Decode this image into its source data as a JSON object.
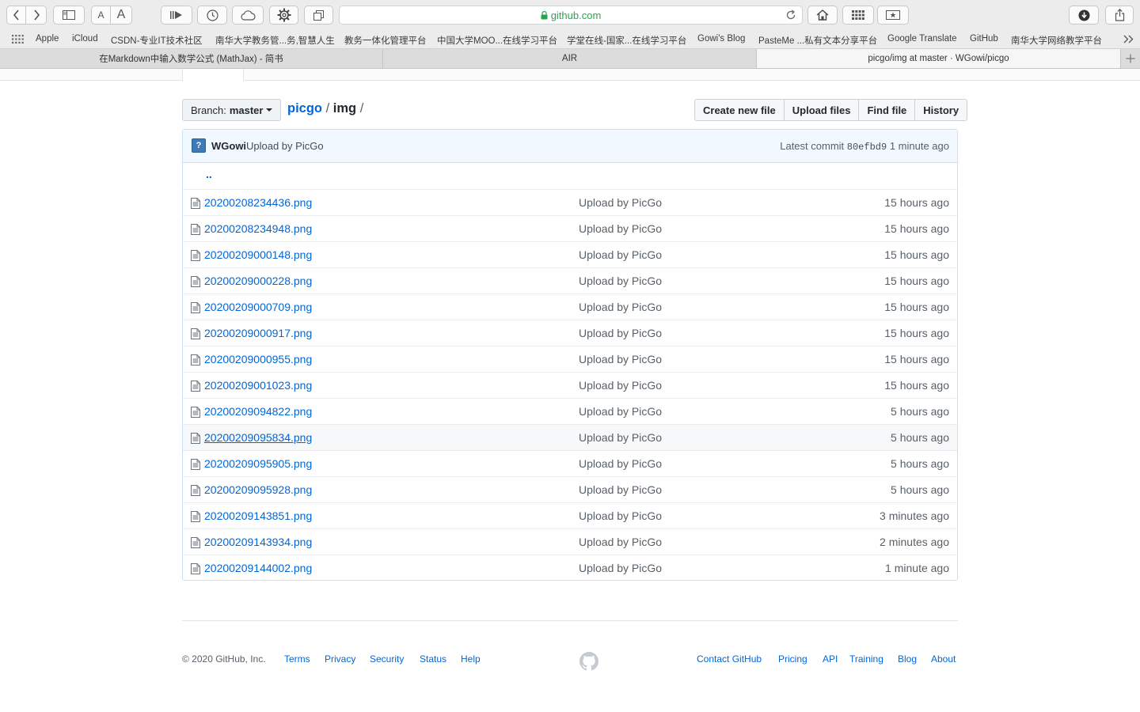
{
  "browser": {
    "address": "github.com",
    "bookmarks": [
      "Apple",
      "iCloud",
      "CSDN-专业IT技术社区",
      "南华大学教务管...务,智慧人生",
      "教务一体化管理平台",
      "中国大学MOO...在线学习平台",
      "学堂在线-国家...在线学习平台",
      "Gowi's Blog",
      "PasteMe ...私有文本分享平台",
      "Google Translate",
      "GitHub",
      "南华大学网络教学平台"
    ],
    "tabs": [
      {
        "label": "在Markdown中输入数学公式 (MathJax) - 简书",
        "active": false
      },
      {
        "label": "AIR",
        "active": false
      },
      {
        "label": "picgo/img at master · WGowi/picgo",
        "active": true
      }
    ]
  },
  "repo": {
    "branch_label": "Branch:",
    "branch_name": "master",
    "repo_name": "picgo",
    "sep1": "/",
    "folder": "img",
    "sep2": "/",
    "buttons": [
      "Create new file",
      "Upload files",
      "Find file",
      "History"
    ]
  },
  "commit": {
    "avatar_glyph": "?",
    "author": "WGowi",
    "message": "Upload by PicGo",
    "latest_label": "Latest commit",
    "sha": "80efbd9",
    "age": "1 minute ago"
  },
  "updir": "..",
  "files": [
    {
      "name": "20200208234436.png",
      "message": "Upload by PicGo",
      "age": "15 hours ago"
    },
    {
      "name": "20200208234948.png",
      "message": "Upload by PicGo",
      "age": "15 hours ago"
    },
    {
      "name": "20200209000148.png",
      "message": "Upload by PicGo",
      "age": "15 hours ago"
    },
    {
      "name": "20200209000228.png",
      "message": "Upload by PicGo",
      "age": "15 hours ago"
    },
    {
      "name": "20200209000709.png",
      "message": "Upload by PicGo",
      "age": "15 hours ago"
    },
    {
      "name": "20200209000917.png",
      "message": "Upload by PicGo",
      "age": "15 hours ago"
    },
    {
      "name": "20200209000955.png",
      "message": "Upload by PicGo",
      "age": "15 hours ago"
    },
    {
      "name": "20200209001023.png",
      "message": "Upload by PicGo",
      "age": "15 hours ago"
    },
    {
      "name": "20200209094822.png",
      "message": "Upload by PicGo",
      "age": "5 hours ago"
    },
    {
      "name": "20200209095834.png",
      "message": "Upload by PicGo",
      "age": "5 hours ago"
    },
    {
      "name": "20200209095905.png",
      "message": "Upload by PicGo",
      "age": "5 hours ago"
    },
    {
      "name": "20200209095928.png",
      "message": "Upload by PicGo",
      "age": "5 hours ago"
    },
    {
      "name": "20200209143851.png",
      "message": "Upload by PicGo",
      "age": "3 minutes ago"
    },
    {
      "name": "20200209143934.png",
      "message": "Upload by PicGo",
      "age": "2 minutes ago"
    },
    {
      "name": "20200209144002.png",
      "message": "Upload by PicGo",
      "age": "1 minute ago"
    }
  ],
  "hovered_file_index": 9,
  "footer": {
    "copyright": "© 2020 GitHub, Inc.",
    "left_links": [
      "Terms",
      "Privacy",
      "Security",
      "Status",
      "Help"
    ],
    "right_links": [
      "Contact GitHub",
      "Pricing",
      "API",
      "Training",
      "Blog",
      "About"
    ]
  },
  "colors": {
    "link": "#0366d6",
    "secure": "#2aa44f",
    "commit_bg": "#f1f8ff"
  }
}
